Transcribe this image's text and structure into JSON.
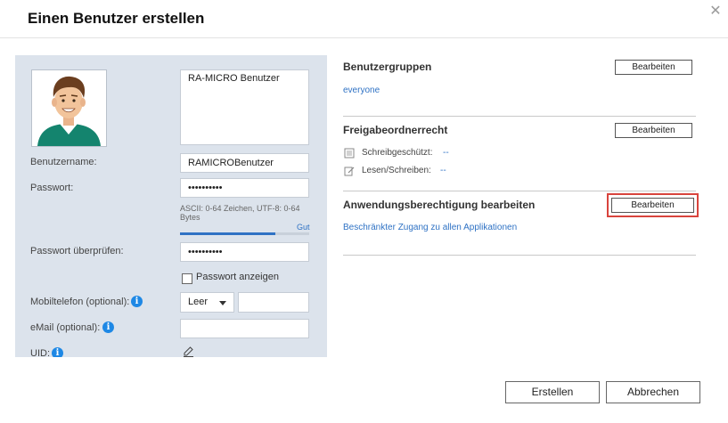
{
  "dialog": {
    "title": "Einen Benutzer erstellen",
    "close_icon": "close-icon"
  },
  "user_form": {
    "description": "RA-MICRO Benutzer",
    "username_label": "Benutzername:",
    "username_value": "RAMICROBenutzer",
    "password_label": "Passwort:",
    "password_value": "••••••••••",
    "password_hint": "ASCII: 0-64 Zeichen, UTF-8: 0-64 Bytes",
    "password_strength_label": "Gut",
    "password_strength_fraction": 0.74,
    "confirm_label": "Passwort überprüfen:",
    "confirm_value": "••••••••••",
    "show_password_label": "Passwort anzeigen",
    "show_password_checked": false,
    "mobile_label": "Mobiltelefon (optional):",
    "mobile_country_value": "Leer",
    "mobile_value": "",
    "email_label": "eMail (optional):",
    "email_value": "",
    "uid_label": "UID:",
    "info_icon_glyph": "i"
  },
  "sections": {
    "groups": {
      "title": "Benutzergruppen",
      "button": "Bearbeiten",
      "value": "everyone"
    },
    "shared_folders": {
      "title": "Freigabeordnerrecht",
      "button": "Bearbeiten",
      "readonly_label": "Schreibgeschützt:",
      "readonly_value": "--",
      "readwrite_label": "Lesen/Schreiben:",
      "readwrite_value": "--"
    },
    "app_privileges": {
      "title": "Anwendungsberechtigung bearbeiten",
      "button": "Bearbeiten",
      "value": "Beschränkter Zugang zu allen Applikationen"
    }
  },
  "footer": {
    "create_label": "Erstellen",
    "cancel_label": "Abbrechen"
  },
  "colors": {
    "link": "#2f72c4",
    "panel_bg": "#dce3ec",
    "highlight": "#d9443d",
    "info_icon": "#1e88e5"
  }
}
